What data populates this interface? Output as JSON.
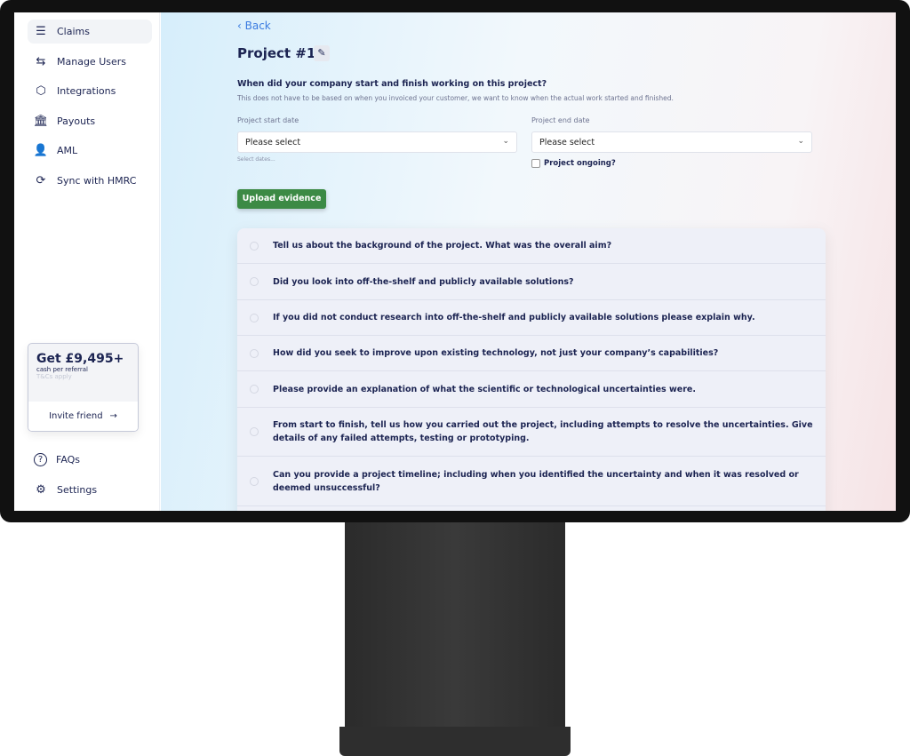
{
  "sidebar": {
    "items": [
      {
        "label": "Claims",
        "icon": "claims-icon",
        "glyph": "☰"
      },
      {
        "label": "Manage Users",
        "icon": "arrows-swap-icon",
        "glyph": "⇆"
      },
      {
        "label": "Integrations",
        "icon": "cube-icon",
        "glyph": "⬡"
      },
      {
        "label": "Payouts",
        "icon": "bank-icon",
        "glyph": "🏛"
      },
      {
        "label": "AML",
        "icon": "person-scan-icon",
        "glyph": "👤"
      },
      {
        "label": "Sync with HMRC",
        "icon": "sync-icon",
        "glyph": "⟳"
      }
    ],
    "referral": {
      "amount": "Get £9,495+",
      "subtitle": "cash per referral",
      "terms": "T&Cs apply",
      "invite": "Invite friend",
      "arrow": "→"
    },
    "bottom": [
      {
        "label": "FAQs",
        "icon": "question-icon",
        "glyph": "?"
      },
      {
        "label": "Settings",
        "icon": "gear-icon",
        "glyph": "⚙"
      }
    ]
  },
  "main": {
    "back": "‹ Back",
    "title": "Project #1",
    "edit_glyph": "✎",
    "question": "When did your company start and finish working on this project?",
    "question_sub": "This does not have to be based on when you invoiced your customer, we want to know when the actual work started and finished.",
    "start_label": "Project start date",
    "start_value": "Please select",
    "start_hint": "Select dates...",
    "end_label": "Project end date",
    "end_value": "Please select",
    "ongoing": "Project ongoing?",
    "ongoing_checked": false,
    "upload": "Upload evidence",
    "questions": [
      "Tell us about the background of the project. What was the overall aim?",
      "Did you look into off-the-shelf and publicly available solutions?",
      "If you did not conduct research into off-the-shelf and publicly available solutions please explain why.",
      "How did you seek to improve upon existing technology, not just your company’s capabilities?",
      "Please provide an explanation of what the scientific or technological uncertainties were.",
      "From start to finish, tell us how you carried out the project, including attempts to resolve the uncertainties. Give details of any failed attempts, testing or prototyping.",
      "Can you provide a project timeline; including when you identified the uncertainty and when it was resolved or deemed unsuccessful?"
    ]
  }
}
